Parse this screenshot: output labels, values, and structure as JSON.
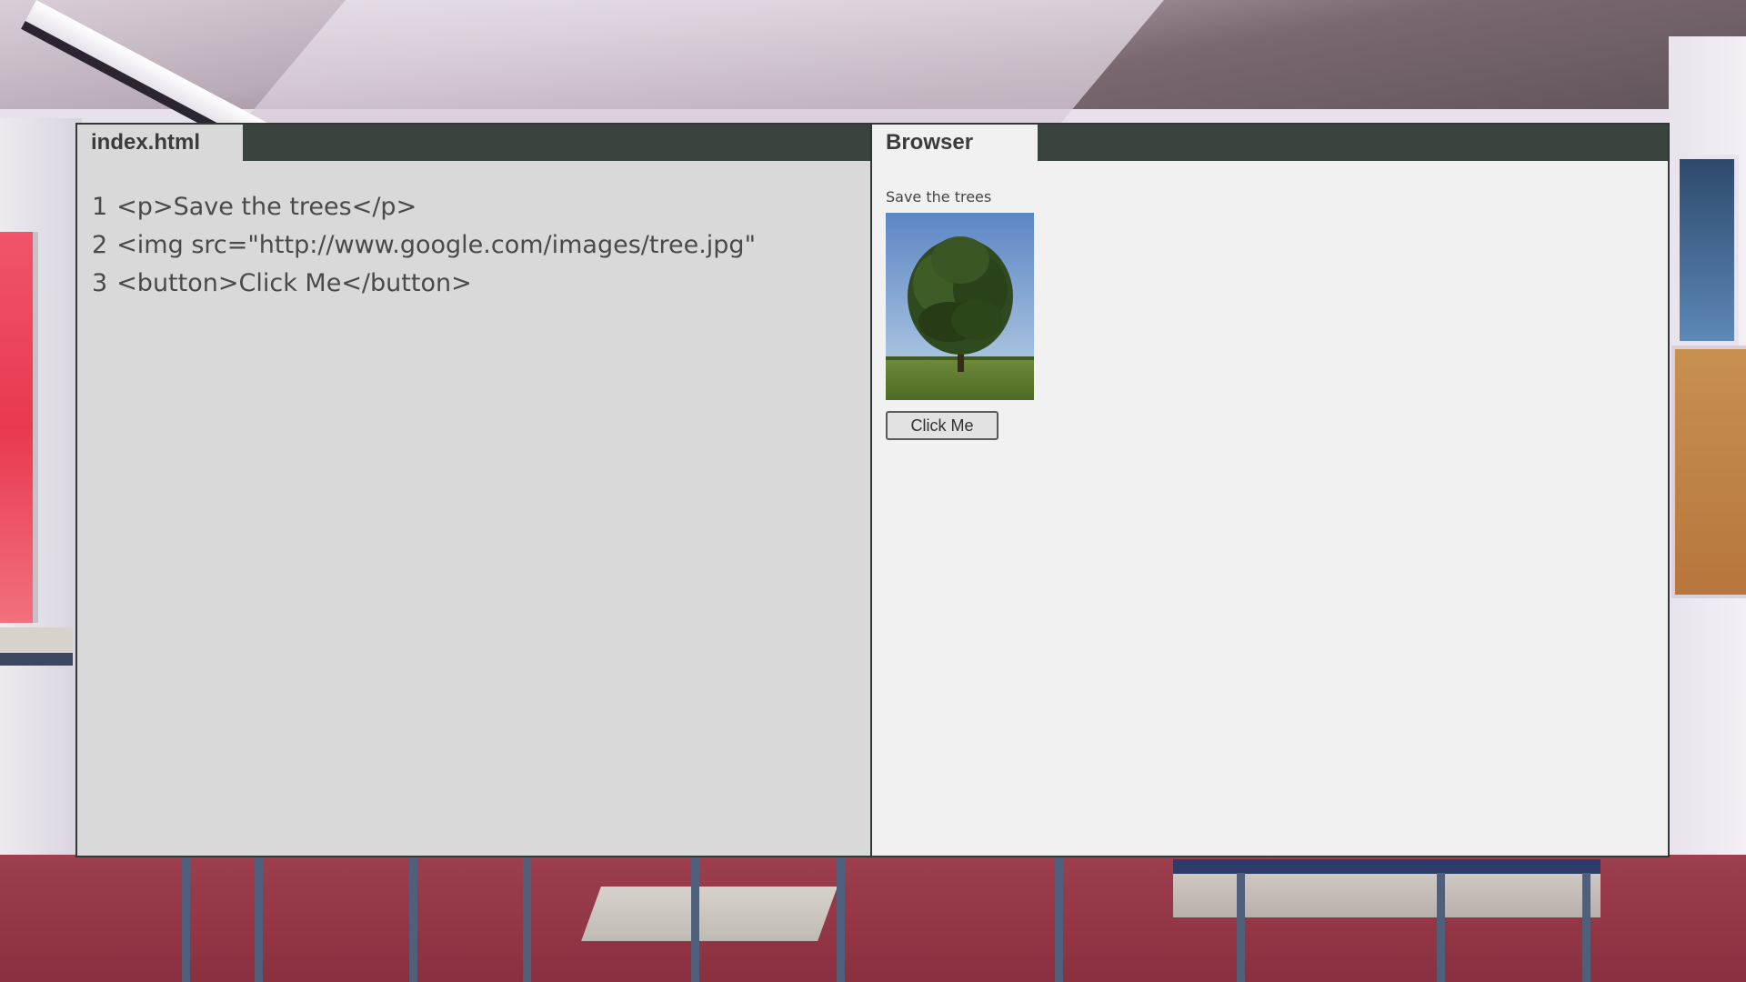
{
  "editor": {
    "tab_label": "index.html",
    "lines": [
      {
        "number": "1",
        "code": "<p>Save the trees</p>"
      },
      {
        "number": "2",
        "code": "<img src=\"http://www.google.com/images/tree.jpg\""
      },
      {
        "number": "3",
        "code": "<button>Click Me</button>"
      }
    ]
  },
  "browser": {
    "tab_label": "Browser",
    "paragraph": "Save the trees",
    "image_icon": "tree-image",
    "button_label": "Click Me"
  },
  "colors": {
    "tabbar": "#3a443f",
    "editor_bg": "#d9d9d9",
    "browser_bg": "#f1f1f1",
    "text": "#4a4a4a"
  }
}
